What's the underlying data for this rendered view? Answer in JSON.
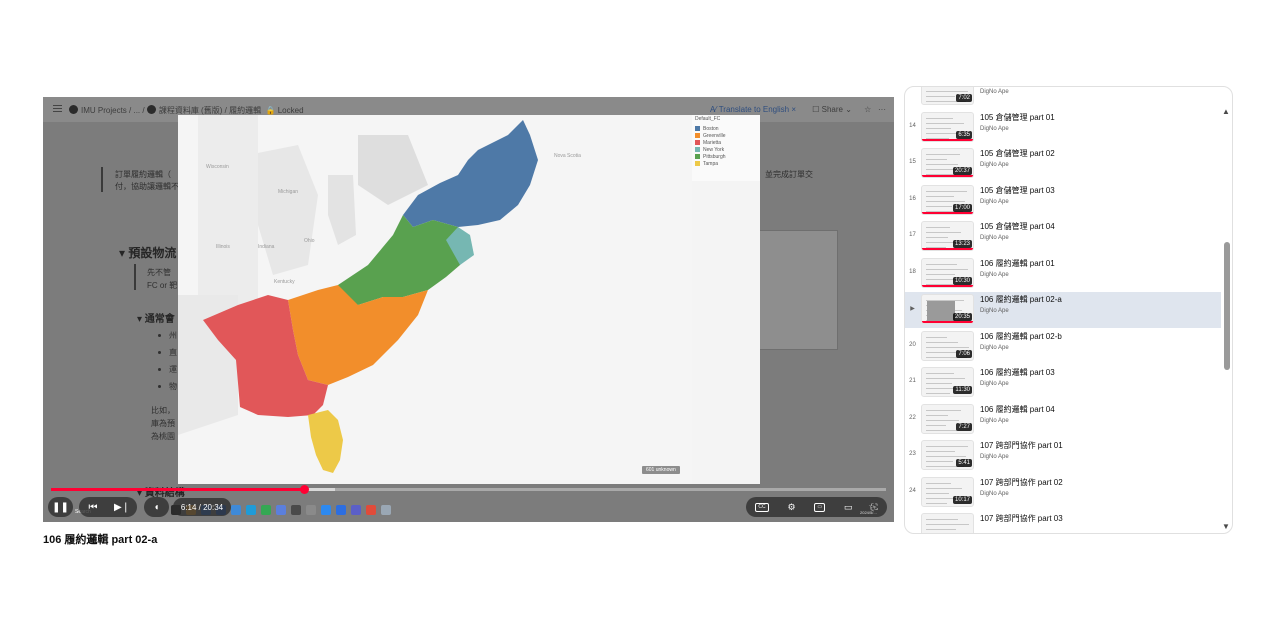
{
  "notion_bar": {
    "crumb_workspace": "IMU Projects",
    "crumb_sep": "/ ... /",
    "crumb_course": "課程資料庫 (舊版)",
    "crumb_page": "/ 履約邏輯",
    "locked": "🔒 Locked",
    "translate": "A⁄ Translate to English  ×",
    "share": "☐ Share ⌄",
    "star": "☆",
    "more": "···"
  },
  "document": {
    "para1_line1": "訂單履約邏輯（",
    "para1_line2": "付，協助讓邏輯不",
    "para1_right": "並完成訂單交",
    "heading1": "▾ 預設物流",
    "sub1_line1": "先不管",
    "sub1_line2": "FC or 靶",
    "heading2": "▾ 通常會",
    "bullets": [
      "州",
      "直",
      "運",
      "物"
    ],
    "para2_line1": "比如，",
    "para2_line2": "庫為預",
    "para2_line3": "為桃園",
    "heading3": "▾ 資料結構"
  },
  "map": {
    "legend_title": "Default_FC",
    "legend": [
      {
        "label": "Boston",
        "color": "#4e79a7"
      },
      {
        "label": "Greenville",
        "color": "#f28e2b"
      },
      {
        "label": "Marietta",
        "color": "#e15759"
      },
      {
        "label": "New York",
        "color": "#76b7b2"
      },
      {
        "label": "Pittsburgh",
        "color": "#59a14f"
      },
      {
        "label": "Tampa",
        "color": "#edc948"
      }
    ],
    "unknown_badge": "601 unknown",
    "place_labels": {
      "wisconsin": "Wisconsin",
      "michigan": "Michigan",
      "illinois": "Illinois",
      "indiana": "Indiana",
      "ohio": "Ohio",
      "kentucky": "Kentucky",
      "nova_scotia": "Nova Scotia"
    }
  },
  "player": {
    "current_time": "6:14",
    "duration": "20:34",
    "time_display": "6:14 / 20:34",
    "progress_fraction": 0.303,
    "buffered_fraction": 0.34,
    "search_text": "Search",
    "play_icon": "pause-icon",
    "clock_line1": "下午 ",
    "clock_line2": "2024/5/..."
  },
  "video_title": "106 履約邏輯 part 02-a",
  "playlist": {
    "items": [
      {
        "index": "",
        "title": "",
        "channel": "DigNo Ape",
        "duration": "7:02"
      },
      {
        "index": "14",
        "title": "105 倉儲管理 part 01",
        "channel": "DigNo Ape",
        "duration": "6:35"
      },
      {
        "index": "15",
        "title": "105 倉儲管理 part 02",
        "channel": "DigNo Ape",
        "duration": "20:37"
      },
      {
        "index": "16",
        "title": "105 倉儲管理 part 03",
        "channel": "DigNo Ape",
        "duration": "17:00"
      },
      {
        "index": "17",
        "title": "105 倉儲管理 part 04",
        "channel": "DigNo Ape",
        "duration": "13:23"
      },
      {
        "index": "18",
        "title": "106 履約邏輯 part 01",
        "channel": "DigNo Ape",
        "duration": "10:30"
      },
      {
        "index": "▶",
        "title": "106 履約邏輯 part 02-a",
        "channel": "DigNo Ape",
        "duration": "20:35",
        "current": true
      },
      {
        "index": "20",
        "title": "106 履約邏輯 part 02-b",
        "channel": "DigNo Ape",
        "duration": "7:06"
      },
      {
        "index": "21",
        "title": "106 履約邏輯 part 03",
        "channel": "DigNo Ape",
        "duration": "11:30"
      },
      {
        "index": "22",
        "title": "106 履約邏輯 part 04",
        "channel": "DigNo Ape",
        "duration": "7:27"
      },
      {
        "index": "23",
        "title": "107 跨部門協作 part 01",
        "channel": "DigNo Ape",
        "duration": "5:41"
      },
      {
        "index": "24",
        "title": "107 跨部門協作 part 02",
        "channel": "DigNo Ape",
        "duration": "10:17"
      },
      {
        "index": "",
        "title": "107 跨部門協作 part 03",
        "channel": "",
        "duration": ""
      }
    ],
    "scroll_up": "▲",
    "scroll_down": "▼"
  }
}
